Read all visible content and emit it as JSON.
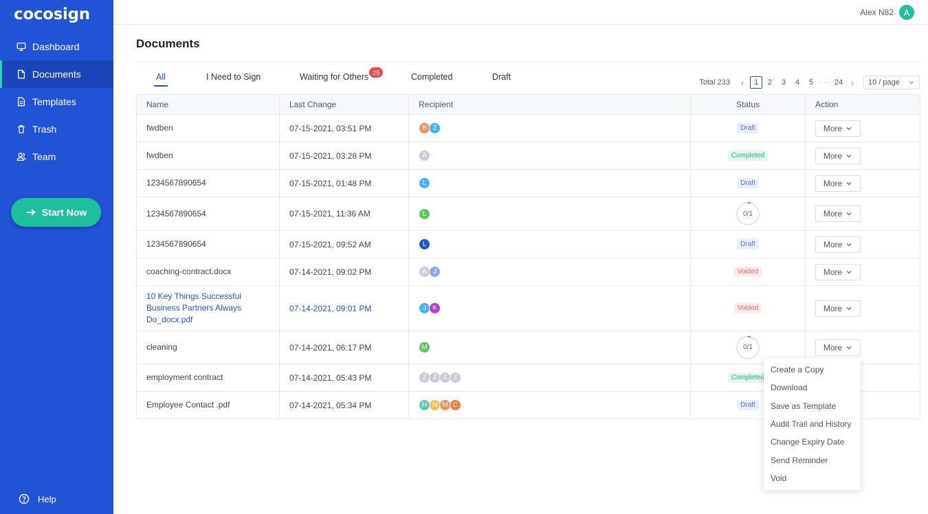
{
  "app": {
    "logo": "cocosign"
  },
  "sidebar": {
    "items": [
      {
        "label": "Dashboard",
        "icon": "monitor-icon"
      },
      {
        "label": "Documents",
        "icon": "document-icon",
        "active": true
      },
      {
        "label": "Templates",
        "icon": "template-icon"
      },
      {
        "label": "Trash",
        "icon": "trash-icon"
      },
      {
        "label": "Team",
        "icon": "team-icon"
      }
    ],
    "start_label": "Start Now",
    "help_label": "Help"
  },
  "user": {
    "name": "Alex N82",
    "initial": "A"
  },
  "page": {
    "title": "Documents"
  },
  "tabs": [
    {
      "label": "All",
      "active": true
    },
    {
      "label": "I Need to Sign"
    },
    {
      "label": "Waiting for Others",
      "badge": "25"
    },
    {
      "label": "Completed"
    },
    {
      "label": "Draft"
    }
  ],
  "pagination": {
    "total": "Total 233",
    "pages": [
      "1",
      "2",
      "3",
      "4",
      "5"
    ],
    "dots": "···",
    "last": "24",
    "current": "1",
    "page_size": "10 / page"
  },
  "table": {
    "headers": {
      "name": "Name",
      "last_change": "Last Change",
      "recipient": "Recipient",
      "status": "Status",
      "action": "Action"
    },
    "more_label": "More",
    "rows": [
      {
        "name": "fwdben",
        "date": "07-15-2021, 03:51 PM",
        "recipients": [
          {
            "i": "B",
            "c": "#f0915e"
          },
          {
            "i": "Z",
            "c": "#40b6ee"
          }
        ],
        "status": "Draft"
      },
      {
        "name": "fwdben",
        "date": "07-15-2021, 03:28 PM",
        "recipients": [
          {
            "i": "A",
            "c": "#c8ccd6"
          }
        ],
        "status": "Completed"
      },
      {
        "name": "1234567890654",
        "date": "07-15-2021, 01:48 PM",
        "recipients": [
          {
            "i": "L",
            "c": "#40b6ee"
          }
        ],
        "status": "Draft"
      },
      {
        "name": "1234567890654",
        "date": "07-15-2021, 11:36 AM",
        "recipients": [
          {
            "i": "L",
            "c": "#5bc758"
          }
        ],
        "status": "0/1"
      },
      {
        "name": "1234567890654",
        "date": "07-15-2021, 09:52 AM",
        "recipients": [
          {
            "i": "L",
            "c": "#2153d7"
          }
        ],
        "status": "Draft"
      },
      {
        "name": "coaching-contract.docx",
        "date": "07-14-2021, 09:02 PM",
        "recipients": [
          {
            "i": "A",
            "c": "#c8ccd6"
          },
          {
            "i": "J",
            "c": "#8fa7e8"
          }
        ],
        "status": "Voided"
      },
      {
        "name": "10 Key Things Successful Business Partners Always Do_docx.pdf",
        "date": "07-14-2021, 09:01 PM",
        "recipients": [
          {
            "i": "J",
            "c": "#40b6ee"
          },
          {
            "i": "K",
            "c": "#b53ad6"
          }
        ],
        "status": "Voided"
      },
      {
        "name": "cleaning",
        "date": "07-14-2021, 06:17 PM",
        "recipients": [
          {
            "i": "M",
            "c": "#5bc758"
          }
        ],
        "status": "0/1"
      },
      {
        "name": "employment contract",
        "date": "07-14-2021, 05:43 PM",
        "recipients": [
          {
            "i": "Z",
            "c": "#c8ccd6"
          },
          {
            "i": "Z",
            "c": "#c8ccd6"
          },
          {
            "i": "Z",
            "c": "#c8ccd6"
          },
          {
            "i": "Z",
            "c": "#c8ccd6"
          }
        ],
        "status": "Completed"
      },
      {
        "name": "Employee Contact .pdf",
        "date": "07-14-2021, 05:34 PM",
        "recipients": [
          {
            "i": "H",
            "c": "#5cc9b4"
          },
          {
            "i": "N",
            "c": "#f3c05a"
          },
          {
            "i": "M",
            "c": "#f0915e"
          },
          {
            "i": "C",
            "c": "#f07a4a"
          }
        ],
        "status": "Draft"
      }
    ]
  },
  "menu": {
    "items": [
      "Create a Copy",
      "Download",
      "Save as Template",
      "Audit Trail and History",
      "Change Expiry Date",
      "Send Reminder",
      "Void"
    ]
  }
}
